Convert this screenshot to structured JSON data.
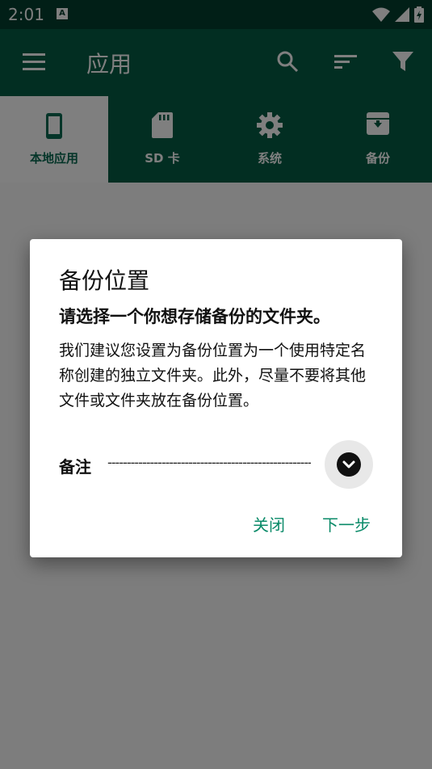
{
  "status_bar": {
    "time": "2:01",
    "a_badge": "A"
  },
  "toolbar": {
    "title": "应用"
  },
  "tabs": [
    {
      "label": "本地应用",
      "icon": "phone-icon",
      "active": true
    },
    {
      "label": "SD 卡",
      "icon": "sd-card-icon",
      "active": false
    },
    {
      "label": "系统",
      "icon": "gear-icon",
      "active": false
    },
    {
      "label": "备份",
      "icon": "archive-icon",
      "active": false
    }
  ],
  "dialog": {
    "title": "备份位置",
    "subtitle": "请选择一个你想存储备份的文件夹。",
    "body": "我们建议您设置为备份位置为一个使用特定名称创建的独立文件夹。此外，尽量不要将其他文件或文件夹放在备份位置。",
    "note_label": "备注",
    "note_value": "----------------------------------------------------------------",
    "close_label": "关闭",
    "next_label": "下一步"
  },
  "colors": {
    "status_bar": "#033e2f",
    "toolbar": "#045c45",
    "accent": "#0a8a68"
  }
}
